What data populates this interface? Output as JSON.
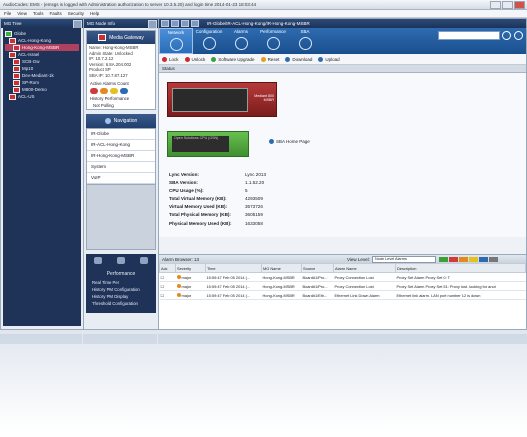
{
  "window": {
    "title": "AudioCodes: EMS - (emsgs is logged with Administration authorization to server 10.3.5.20) and login time 2014-01-23 18:03:44",
    "menu": [
      "File",
      "View",
      "Tools",
      "Faults",
      "Security",
      "Help"
    ]
  },
  "mg_tree": {
    "title": "MG Tree",
    "items": [
      {
        "label": "Globe",
        "level": 0,
        "selected": false
      },
      {
        "label": "ACL-Hong-Kong",
        "level": 1,
        "selected": false
      },
      {
        "label": "Hong-Kong-MSBR",
        "level": 2,
        "selected": true
      },
      {
        "label": "ACL-Israel",
        "level": 1,
        "selected": false
      },
      {
        "label": "SCB-Gw",
        "level": 2,
        "selected": false
      },
      {
        "label": "Mp10",
        "level": 2,
        "selected": false
      },
      {
        "label": "Dev-Mediant-1k",
        "level": 2,
        "selected": false
      },
      {
        "label": "SP-Rom",
        "level": 2,
        "selected": false
      },
      {
        "label": "M800-Demo",
        "level": 2,
        "selected": false
      },
      {
        "label": "ACL-US",
        "level": 1,
        "selected": false
      }
    ]
  },
  "node_info": {
    "title": "MG Node Info",
    "header": "Media Gateway",
    "lines": [
      "Name: Hong-Kong-MSBR",
      "Admin State: Unlocked",
      "IP: 10.7.2.12",
      "Version: 6.8A.204.002",
      "Product SP",
      "SBA IP: 10.7.87.127"
    ],
    "active_alarms_label": "Active Alarms Count",
    "history_label": "History Performance",
    "not_polling": "Not Polling"
  },
  "navigation": {
    "title": "Navigation",
    "items": [
      "IR-Globe",
      "IR-ACL-Hong-Kong",
      "IR-Hong-Kong-MSBR",
      "System",
      "VoIP"
    ]
  },
  "performance": {
    "title": "Performance",
    "items": [
      "Real Time Per",
      "History PM Configuration",
      "History PM Display",
      "Threshold Configuration"
    ]
  },
  "main": {
    "breadcrumb": "IR-Globe/IR-ACL-Hong-Kong/IR-Hong-Kong-MSBR",
    "tabs": [
      {
        "label": "Network",
        "icon": "network-icon",
        "active": true
      },
      {
        "label": "Configuration",
        "icon": "gear-icon",
        "active": false
      },
      {
        "label": "Alarms",
        "icon": "alarm-icon",
        "active": false
      },
      {
        "label": "Performance",
        "icon": "chart-icon",
        "active": false
      },
      {
        "label": "SBA",
        "icon": "phone-icon",
        "active": false
      }
    ],
    "actions": [
      {
        "label": "Lock",
        "color": "#cc2a2a"
      },
      {
        "label": "Unlock",
        "color": "#cc2a2a"
      },
      {
        "label": "Software Upgrade",
        "color": "#3aa03a"
      },
      {
        "label": "Reset",
        "color": "#e0a020"
      },
      {
        "label": "Download",
        "color": "#2d6bb0"
      },
      {
        "label": "Upload",
        "color": "#2d6bb0"
      }
    ],
    "status_label": "Status",
    "device1_tag": [
      "Mediant 800",
      "MSBR"
    ],
    "device2_label": "Open Solutions CPU (OSN)",
    "sba_link": "SBA Home Page",
    "properties": [
      {
        "key": "Lync Version:",
        "value": "Lync 2013"
      },
      {
        "key": "SBA Version:",
        "value": "1.1.52.20"
      },
      {
        "key": "CPU Usage (%):",
        "value": "5"
      },
      {
        "key": "Total Virtual Memory (KB):",
        "value": "4293509"
      },
      {
        "key": "Virtual Memory Used (KB):",
        "value": "3573726"
      },
      {
        "key": "Total Physical Memory (KB):",
        "value": "3605159"
      },
      {
        "key": "Physical Memory Used (KB):",
        "value": "1633058"
      }
    ]
  },
  "alarm_browser": {
    "title": "Alarm Browser: 13",
    "view_level_label": "View Level:",
    "view_level_value": "Node Level Alarms",
    "severity_colors": [
      "#3aa03a",
      "#d23a3a",
      "#e38a1f",
      "#e3c21f",
      "#2d6bb0",
      "#777777"
    ],
    "columns": [
      "Ack",
      "Severity",
      "Time",
      "MG Name",
      "Source",
      "Alarm Name",
      "Description"
    ],
    "rows": [
      {
        "severity": "major",
        "color": "#e38a1f",
        "time": "15:59:47 Feb 05 2014 (...",
        "mg": "Hong-Kong-MSBR",
        "source": "Board#1/Pro...",
        "alarm": "Proxy Connection Lost",
        "desc": "Proxy Set Alarm Proxy Set 0: T"
      },
      {
        "severity": "major",
        "color": "#e38a1f",
        "time": "15:59:47 Feb 05 2014 (...",
        "mg": "Hong-Kong-MSBR",
        "source": "Board#1/Pro...",
        "alarm": "Proxy Connection Lost",
        "desc": "Proxy Set Alarm Proxy Set 51: Proxy lost. looking for anot"
      },
      {
        "severity": "major",
        "color": "#e38a1f",
        "time": "15:59:47 Feb 05 2014 (...",
        "mg": "Hong-Kong-MSBR",
        "source": "Board#1/Eth...",
        "alarm": "Ethernet Link Down Alarm",
        "desc": "Ethernet link alarm. LAN port number 12 is down"
      }
    ]
  }
}
